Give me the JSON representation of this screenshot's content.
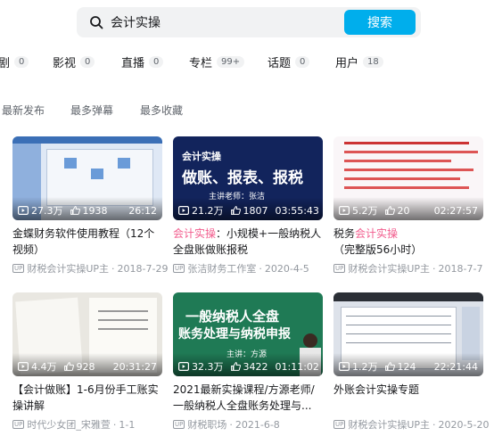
{
  "search": {
    "value": "会计实操",
    "button_label": "搜索"
  },
  "type_tabs": [
    {
      "label": "剧",
      "count": "0"
    },
    {
      "label": "影视",
      "count": "0"
    },
    {
      "label": "直播",
      "count": "0"
    },
    {
      "label": "专栏",
      "count": "99+"
    },
    {
      "label": "话题",
      "count": "0"
    },
    {
      "label": "用户",
      "count": "18"
    }
  ],
  "sort_options": [
    "最新发布",
    "最多弹幕",
    "最多收藏"
  ],
  "videos": [
    {
      "title_pre": "金蝶财务软件使用教程（12个视频）",
      "title_hl": "",
      "title_post": "",
      "views": "27.3万",
      "likes": "1938",
      "duration": "26:12",
      "author": "财税会计实操UP主",
      "date": "2018-7-29",
      "thumb_text": ""
    },
    {
      "title_pre": "",
      "title_hl": "会计实操",
      "title_post": "：小规模+一般纳税人全盘账做账报税",
      "views": "21.2万",
      "likes": "1807",
      "duration": "03:55:43",
      "author": "张洁财务工作室",
      "date": "2020-4-5",
      "thumb_text": "会计实操",
      "thumb_main": "做账、报表、报税",
      "thumb_sub": "主讲老师：张洁"
    },
    {
      "title_pre": "税务",
      "title_hl": "会计实操",
      "title_post": "（完整版56小时）",
      "views": "5.2万",
      "likes": "20",
      "duration": "02:27:57",
      "author": "财税会计实操UP主",
      "date": "2018-7-7",
      "thumb_text": ""
    },
    {
      "title_pre": "【会计做账】1-6月份手工账实操讲解",
      "title_hl": "",
      "title_post": "",
      "views": "4.4万",
      "likes": "928",
      "duration": "20:31:27",
      "author": "时代少女团_宋雅萱",
      "date": "1-1",
      "thumb_text": ""
    },
    {
      "title_pre": "2021最新实操课程/方源老师/一般纳税人全盘账务处理与...",
      "title_hl": "",
      "title_post": "",
      "views": "32.3万",
      "likes": "3422",
      "duration": "01:11:02",
      "author": "财税职场",
      "date": "2021-6-8",
      "thumb_text": "一般纳税人全盘",
      "thumb_main": "账务处理与纳税申报",
      "thumb_sub": "主讲：方源"
    },
    {
      "title_pre": "外账会计实操专题",
      "title_hl": "",
      "title_post": "",
      "views": "1.2万",
      "likes": "124",
      "duration": "22:21:44",
      "author": "财税会计实操UP主",
      "date": "2020-5-20",
      "thumb_text": ""
    }
  ]
}
